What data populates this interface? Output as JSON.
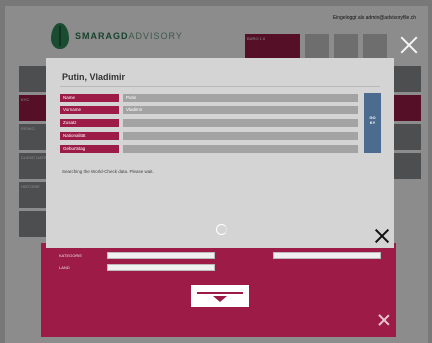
{
  "app": {
    "brand_strong": "SMARAGD",
    "brand_light": "ADVISORY",
    "user_line": "Eingeloggt als admin@advisoryfile.ch",
    "tabs": [
      {
        "label": "BÜRO 1.0",
        "active": true
      },
      {
        "label": "",
        "active": false
      },
      {
        "label": "",
        "active": false
      },
      {
        "label": "",
        "active": false
      }
    ],
    "sidebar_left": [
      {
        "label": "",
        "active": false
      },
      {
        "label": "KYC",
        "active": true
      },
      {
        "label": "RISIKO",
        "active": false
      },
      {
        "label": "CLIENT DATEN",
        "active": false
      },
      {
        "label": "HISTORIE",
        "active": false
      },
      {
        "label": "",
        "active": false
      }
    ],
    "bottom": {
      "row1_label": "KATEGORIE",
      "row2_label": "LAND"
    }
  },
  "modal": {
    "title": "Putin, Vladimir",
    "fields": [
      {
        "label": "Name",
        "value": "Putin"
      },
      {
        "label": "Vorname",
        "value": "Vladimir"
      },
      {
        "label": "Zusatz",
        "value": ""
      },
      {
        "label": "Nationalität",
        "value": ""
      },
      {
        "label": "Geburtstag",
        "value": ""
      }
    ],
    "go_button": "GO\nKY",
    "status": "Searching the World-Check data. Please wait.",
    "colors": {
      "accent": "#9c1c47",
      "go": "#4b6c8e",
      "modal_bg": "#d4d4d4"
    }
  }
}
